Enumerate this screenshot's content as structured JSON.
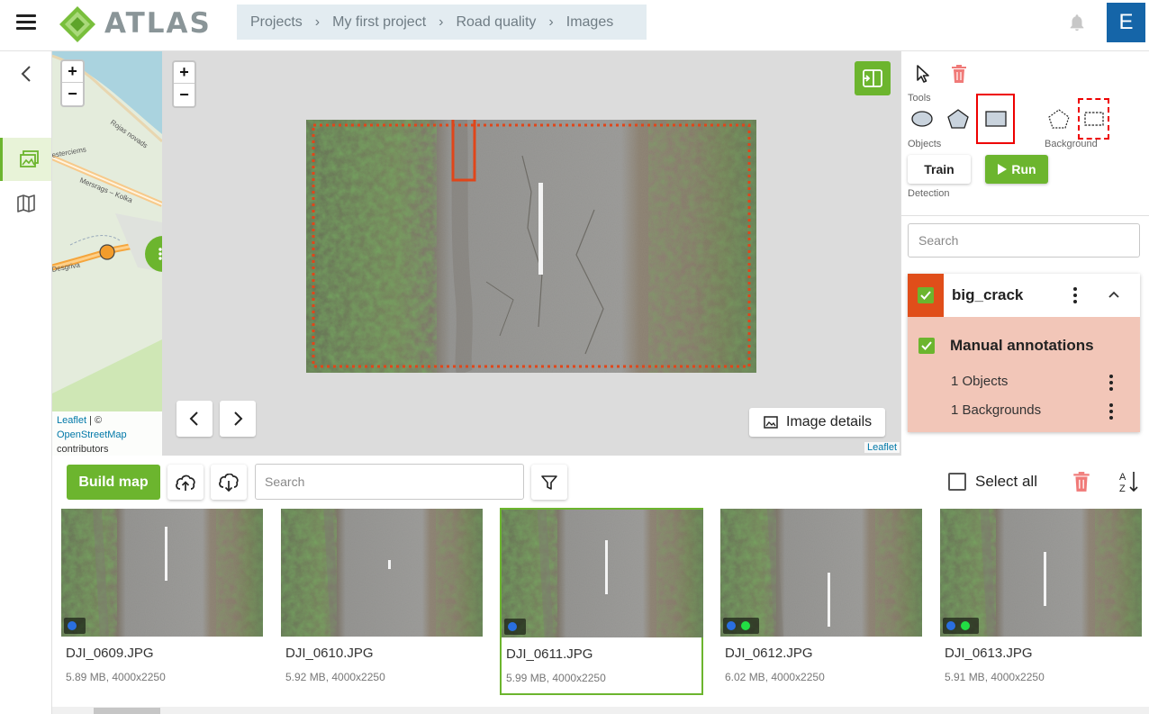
{
  "app": {
    "logo_text": "ATLAS",
    "avatar_initial": "E"
  },
  "breadcrumb": [
    "Projects",
    "My first project",
    "Road quality",
    "Images"
  ],
  "minimap": {
    "zoom_in": "+",
    "zoom_out": "−",
    "attribution_link1": "Leaflet",
    "attribution_sep": " | © ",
    "attribution_link2": "OpenStreetMap",
    "attribution_tail": "contributors",
    "road_labels": [
      "Rojas novads",
      "Mersrags – Kolka",
      "esterciems",
      "Desgriva"
    ]
  },
  "viewer": {
    "zoom_in": "+",
    "zoom_out": "−",
    "image_details_label": "Image details",
    "leaflet_label": "Leaflet"
  },
  "tools": {
    "tools_label": "Tools",
    "objects_label": "Objects",
    "background_label": "Background",
    "detection_label": "Detection",
    "train_label": "Train",
    "run_label": "Run",
    "icons": [
      "pointer-icon",
      "trash-icon",
      "ellipse-icon",
      "polygon-icon",
      "rectangle-icon",
      "dashed-polygon-icon",
      "dashed-rectangle-icon"
    ],
    "accent_color": "#6cb52e",
    "danger_color": "#e53935"
  },
  "panel": {
    "search_placeholder": "Search",
    "class_name": "big_crack",
    "class_color": "#e04e1a",
    "group_label": "Manual annotations",
    "objects_count": "1 Objects",
    "backgrounds_count": "1 Backgrounds"
  },
  "bottom": {
    "build_map_label": "Build map",
    "search_placeholder": "Search",
    "select_all_label": "Select all"
  },
  "thumbnails": [
    {
      "name": "DJI_0609.JPG",
      "meta": "5.89 MB, 4000x2250",
      "dots": [
        "#2a6fe0"
      ],
      "selected": false
    },
    {
      "name": "DJI_0610.JPG",
      "meta": "5.92 MB, 4000x2250",
      "dots": [],
      "selected": false
    },
    {
      "name": "DJI_0611.JPG",
      "meta": "5.99 MB, 4000x2250",
      "dots": [
        "#2a6fe0"
      ],
      "selected": true
    },
    {
      "name": "DJI_0612.JPG",
      "meta": "6.02 MB, 4000x2250",
      "dots": [
        "#2a6fe0",
        "#22dd44"
      ],
      "selected": false
    },
    {
      "name": "DJI_0613.JPG",
      "meta": "5.91 MB, 4000x2250",
      "dots": [
        "#2a6fe0",
        "#22dd44"
      ],
      "selected": false
    }
  ]
}
